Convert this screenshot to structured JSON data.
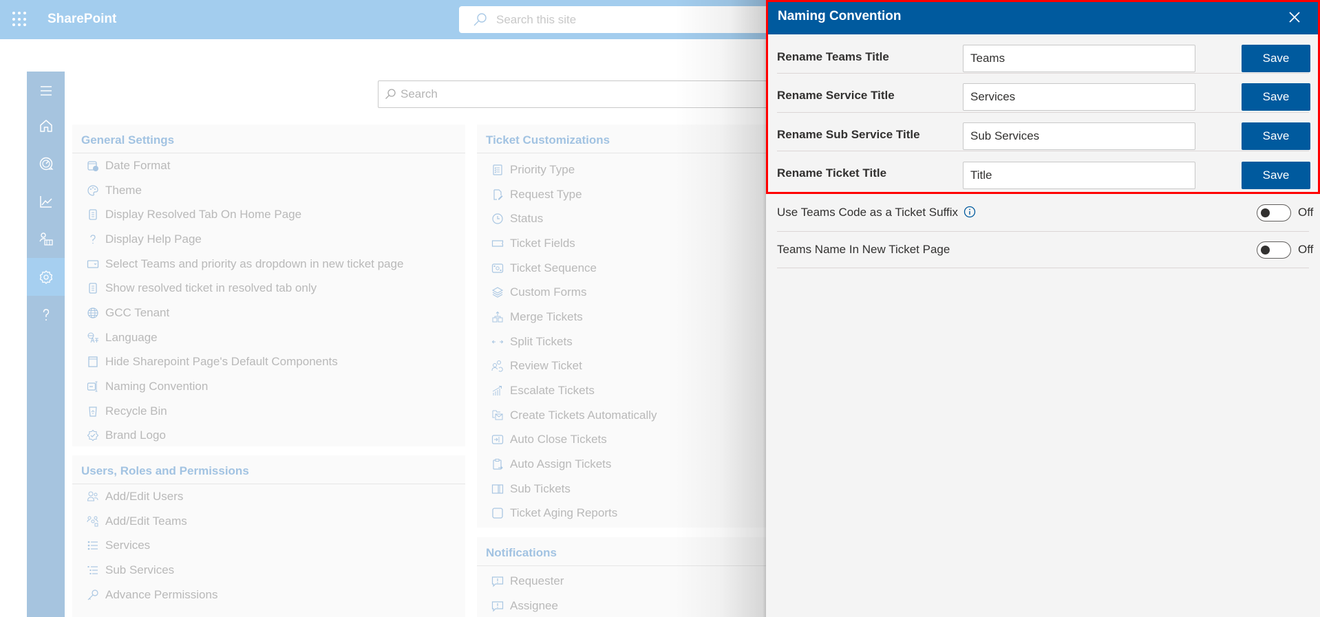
{
  "suitebar": {
    "app_name": "SharePoint",
    "search_placeholder": "Search this site",
    "icons": {
      "launcher": "waffle-grid-icon",
      "search": "search-icon"
    }
  },
  "rail": {
    "items": [
      {
        "name": "menu",
        "icon": "hamburger-menu-icon",
        "active": false
      },
      {
        "name": "home",
        "icon": "home-icon",
        "active": false
      },
      {
        "name": "dashboard",
        "icon": "speedometer-icon",
        "active": false
      },
      {
        "name": "reports",
        "icon": "line-chart-icon",
        "active": false
      },
      {
        "name": "people",
        "icon": "people-group-icon",
        "active": false
      },
      {
        "name": "settings",
        "icon": "gear-icon",
        "active": true
      },
      {
        "name": "help",
        "icon": "question-mark-icon",
        "active": false
      }
    ]
  },
  "main": {
    "search_placeholder": "Search",
    "sections": {
      "general": {
        "title": "General Settings",
        "items": [
          {
            "label": "Date Format",
            "icon": "calendar-clock-icon"
          },
          {
            "label": "Theme",
            "icon": "palette-icon"
          },
          {
            "label": "Display Resolved Tab On Home Page",
            "icon": "document-icon"
          },
          {
            "label": "Display Help Page",
            "icon": "question-mark-icon"
          },
          {
            "label": "Select Teams and priority as dropdown in new ticket page",
            "icon": "dropdown-box-icon"
          },
          {
            "label": "Show resolved ticket in resolved tab only",
            "icon": "document-icon"
          },
          {
            "label": "GCC Tenant",
            "icon": "globe-icon"
          },
          {
            "label": "Language",
            "icon": "translate-icon"
          },
          {
            "label": "Hide Sharepoint Page's Default Components",
            "icon": "window-icon"
          },
          {
            "label": "Naming Convention",
            "icon": "rename-icon"
          },
          {
            "label": "Recycle Bin",
            "icon": "recycle-bin-icon"
          },
          {
            "label": "Brand Logo",
            "icon": "badge-check-icon"
          }
        ]
      },
      "users": {
        "title": "Users, Roles and Permissions",
        "items": [
          {
            "label": "Add/Edit Users",
            "icon": "people-icon"
          },
          {
            "label": "Add/Edit Teams",
            "icon": "team-icon"
          },
          {
            "label": "Services",
            "icon": "bullet-list-icon"
          },
          {
            "label": "Sub Services",
            "icon": "sub-list-icon"
          },
          {
            "label": "Advance Permissions",
            "icon": "key-icon"
          }
        ]
      },
      "tickets": {
        "title": "Ticket Customizations",
        "items": [
          {
            "label": "Priority Type",
            "icon": "checklist-icon"
          },
          {
            "label": "Request Type",
            "icon": "document-edit-icon"
          },
          {
            "label": "Status",
            "icon": "clock-icon"
          },
          {
            "label": "Ticket Fields",
            "icon": "ticket-icon"
          },
          {
            "label": "Ticket Sequence",
            "icon": "sequence-icon"
          },
          {
            "label": "Custom Forms",
            "icon": "layers-icon"
          },
          {
            "label": "Merge Tickets",
            "icon": "merge-icon"
          },
          {
            "label": "Split Tickets",
            "icon": "split-arrows-icon"
          },
          {
            "label": "Review Ticket",
            "icon": "review-people-icon"
          },
          {
            "label": "Escalate Tickets",
            "icon": "escalate-chart-icon"
          },
          {
            "label": "Create Tickets Automatically",
            "icon": "mail-folder-icon"
          },
          {
            "label": "Auto Close Tickets",
            "icon": "auto-close-icon"
          },
          {
            "label": "Auto Assign Tickets",
            "icon": "clipboard-arrow-icon"
          },
          {
            "label": "Sub Tickets",
            "icon": "split-panel-icon"
          },
          {
            "label": "Ticket Aging Reports",
            "icon": "square-icon"
          }
        ]
      },
      "notifications": {
        "title": "Notifications",
        "items": [
          {
            "label": "Requester",
            "icon": "comment-alert-icon"
          },
          {
            "label": "Assignee",
            "icon": "comment-alert-icon"
          }
        ]
      }
    }
  },
  "panel": {
    "title": "Naming Convention",
    "close_icon": "close-icon",
    "rename_rows": [
      {
        "label": "Rename Teams Title",
        "value": "Teams",
        "button": "Save"
      },
      {
        "label": "Rename Service Title",
        "value": "Services",
        "button": "Save"
      },
      {
        "label": "Rename Sub Service Title",
        "value": "Sub Services",
        "button": "Save"
      },
      {
        "label": "Rename Ticket Title",
        "value": "Title",
        "button": "Save"
      }
    ],
    "toggle_rows": [
      {
        "label": "Use Teams Code as a Ticket Suffix",
        "has_info": true,
        "state": "Off",
        "on": false
      },
      {
        "label": "Teams Name In New Ticket Page",
        "has_info": false,
        "state": "Off",
        "on": false
      }
    ]
  },
  "colors": {
    "suitebar": "#a3cdee",
    "rail": "#a6c4df",
    "rail_active": "#a6cff0",
    "accent": "#005a9e",
    "highlight_border": "#ff0000",
    "section_title": "#a2c3e2",
    "muted_text": "#b9b9b9"
  }
}
